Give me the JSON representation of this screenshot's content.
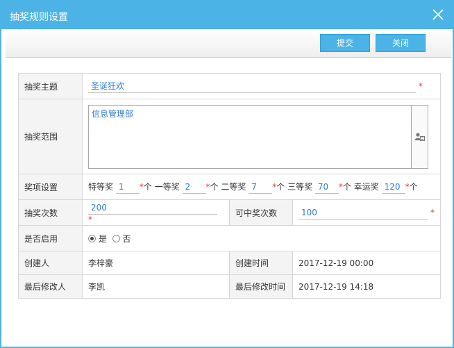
{
  "dialog": {
    "title": "抽奖规则设置"
  },
  "toolbar": {
    "submit_label": "提交",
    "close_label": "关闭"
  },
  "form": {
    "subject": {
      "label": "抽奖主题",
      "value": "圣诞狂欢",
      "required_mark": "*"
    },
    "scope": {
      "label": "抽奖范围",
      "value": "信息管理部"
    },
    "prizes": {
      "label": "奖项设置",
      "unit": "个",
      "required_mark": "*",
      "items": [
        {
          "name": "特等奖",
          "count": "1"
        },
        {
          "name": "一等奖",
          "count": "2"
        },
        {
          "name": "二等奖",
          "count": "7"
        },
        {
          "name": "三等奖",
          "count": "70"
        },
        {
          "name": "幸运奖",
          "count": "120"
        }
      ]
    },
    "draw_times": {
      "label": "抽奖次数",
      "value": "200",
      "required_mark": "*"
    },
    "max_wins": {
      "label": "可中奖次数",
      "value": "100",
      "required_mark": "*"
    },
    "enabled": {
      "label": "是否启用",
      "yes_label": "是",
      "no_label": "否",
      "selected": "yes"
    },
    "creator": {
      "label": "创建人",
      "value": "李梓豪"
    },
    "created_time": {
      "label": "创建时间",
      "value": "2017-12-19 00:00"
    },
    "modifier": {
      "label": "最后修改人",
      "value": "李凯"
    },
    "modified_time": {
      "label": "最后修改时间",
      "value": "2017-12-19 14:18"
    }
  },
  "colors": {
    "accent": "#4cb3e6",
    "value_text": "#2d7dd2",
    "required": "#e23b3b"
  }
}
